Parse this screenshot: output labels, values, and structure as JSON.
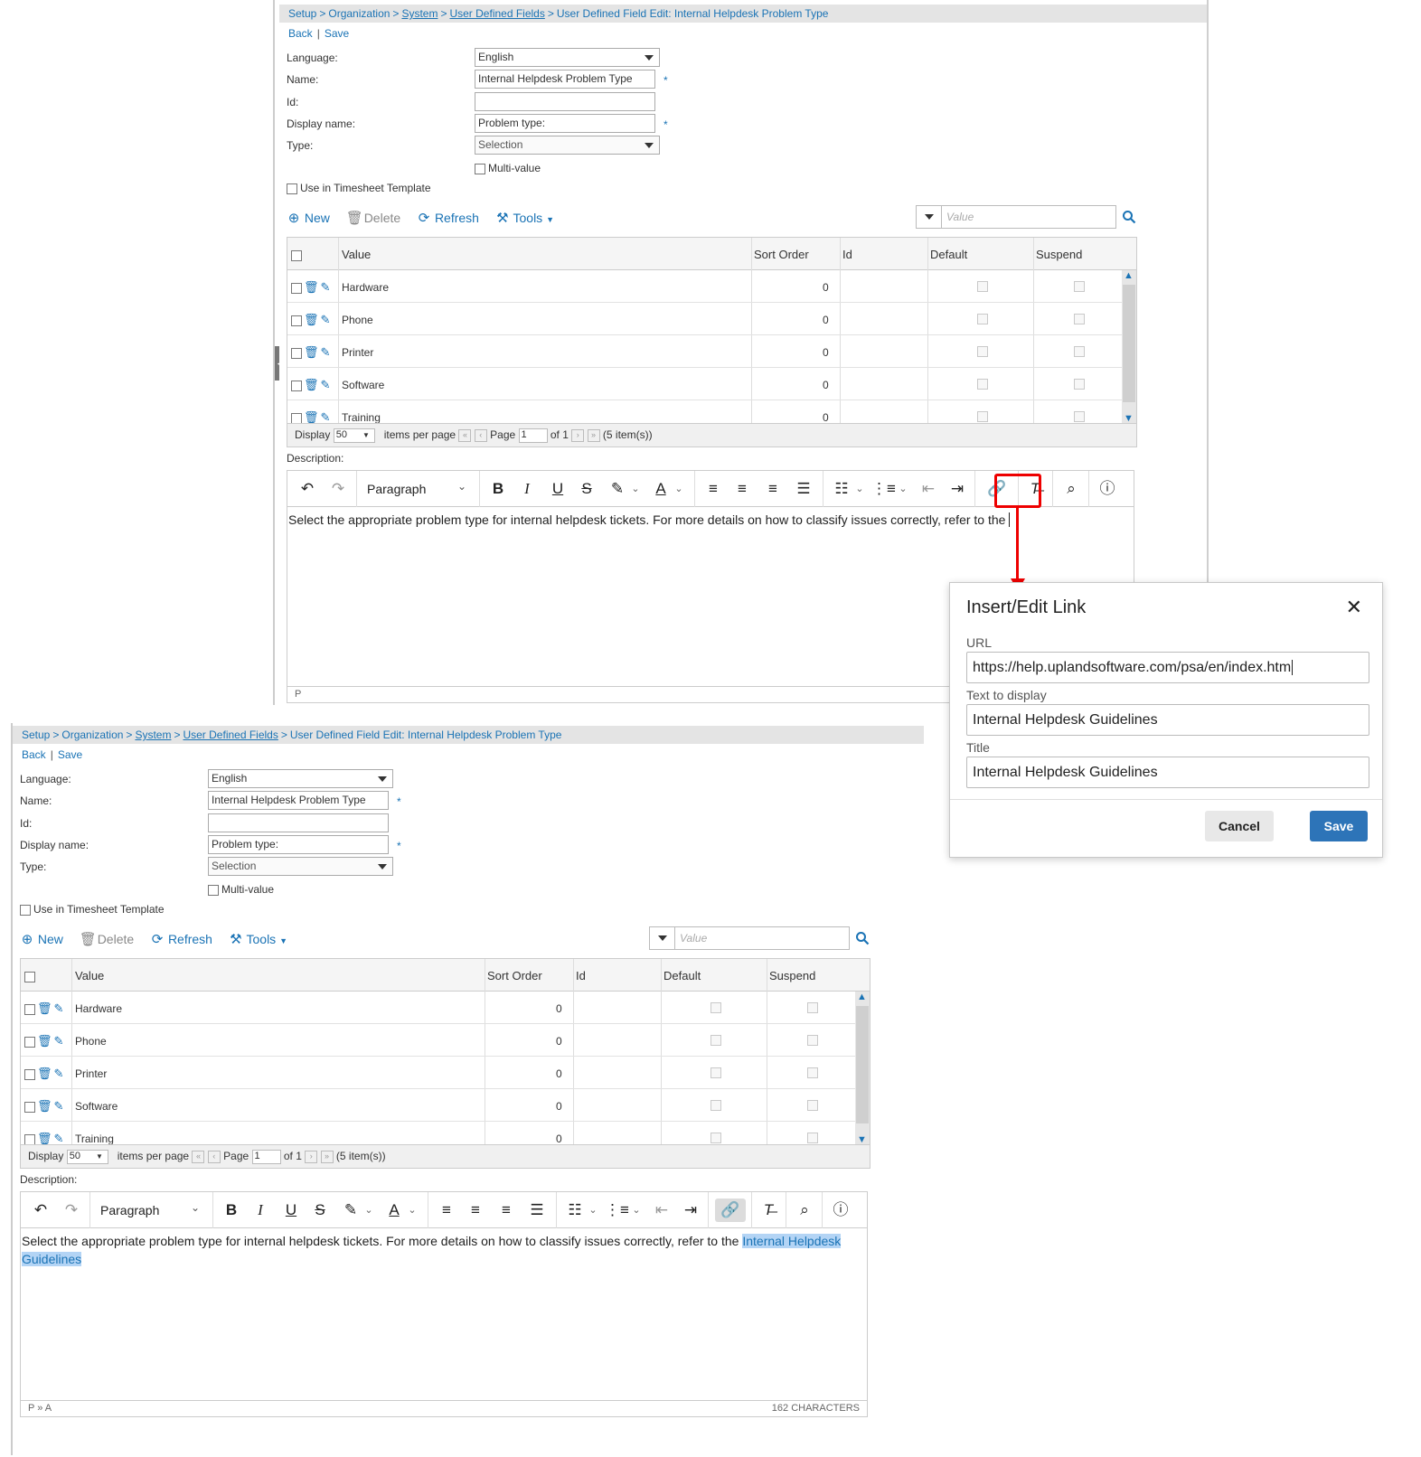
{
  "breadcrumb": {
    "setup": "Setup",
    "organization": "Organization",
    "system": "System",
    "udf": "User Defined Fields",
    "current": "User Defined Field Edit: Internal Helpdesk Problem Type",
    "separator": ">"
  },
  "actions": {
    "back": "Back",
    "save": "Save",
    "pipe": "|"
  },
  "form": {
    "language_label": "Language:",
    "language_value": "English",
    "name_label": "Name:",
    "name_value": "Internal Helpdesk Problem Type",
    "id_label": "Id:",
    "id_value": "",
    "display_name_label": "Display name:",
    "display_name_value": "Problem type:",
    "type_label": "Type:",
    "type_value": "Selection",
    "required_mark": "*",
    "multi_value_label": "Multi-value",
    "timesheet_label": "Use in Timesheet Template"
  },
  "toolbar": {
    "new": "New",
    "delete": "Delete",
    "refresh": "Refresh",
    "tools": "Tools",
    "value_placeholder": "Value"
  },
  "grid": {
    "columns": {
      "value": "Value",
      "sort_order": "Sort Order",
      "id": "Id",
      "default": "Default",
      "suspend": "Suspend"
    },
    "rows": [
      {
        "value": "Hardware",
        "sort_order": "0"
      },
      {
        "value": "Phone",
        "sort_order": "0"
      },
      {
        "value": "Printer",
        "sort_order": "0"
      },
      {
        "value": "Software",
        "sort_order": "0"
      },
      {
        "value": "Training",
        "sort_order": "0"
      }
    ],
    "pager": {
      "display": "Display",
      "per_page": "50",
      "items_per_page": "items per page",
      "page": "Page",
      "page_value": "1",
      "of": "of 1",
      "total": "(5 item(s))"
    }
  },
  "editor": {
    "description_label": "Description:",
    "block_format": "Paragraph",
    "top_content": "Select the appropriate problem type for internal helpdesk tickets. For more details on how to classify issues correctly, refer to the",
    "bottom_content": "Select the appropriate problem type for internal helpdesk tickets. For more details on how to classify issues correctly, refer to the",
    "bottom_link_text": "Internal Helpdesk Guidelines",
    "top_status": "P",
    "bottom_status": "P » A",
    "char_count": "162 CHARACTERS"
  },
  "dialog": {
    "title": "Insert/Edit Link",
    "url_label": "URL",
    "url_value": "https://help.uplandsoftware.com/psa/en/index.htm",
    "text_label": "Text to display",
    "text_value": "Internal Helpdesk Guidelines",
    "title_label": "Title",
    "title_value": "Internal Helpdesk Guidelines",
    "cancel": "Cancel",
    "save": "Save"
  },
  "colors": {
    "link": "#1a73b5",
    "highlight": "#e00000",
    "primary_button": "#2d74b8"
  }
}
